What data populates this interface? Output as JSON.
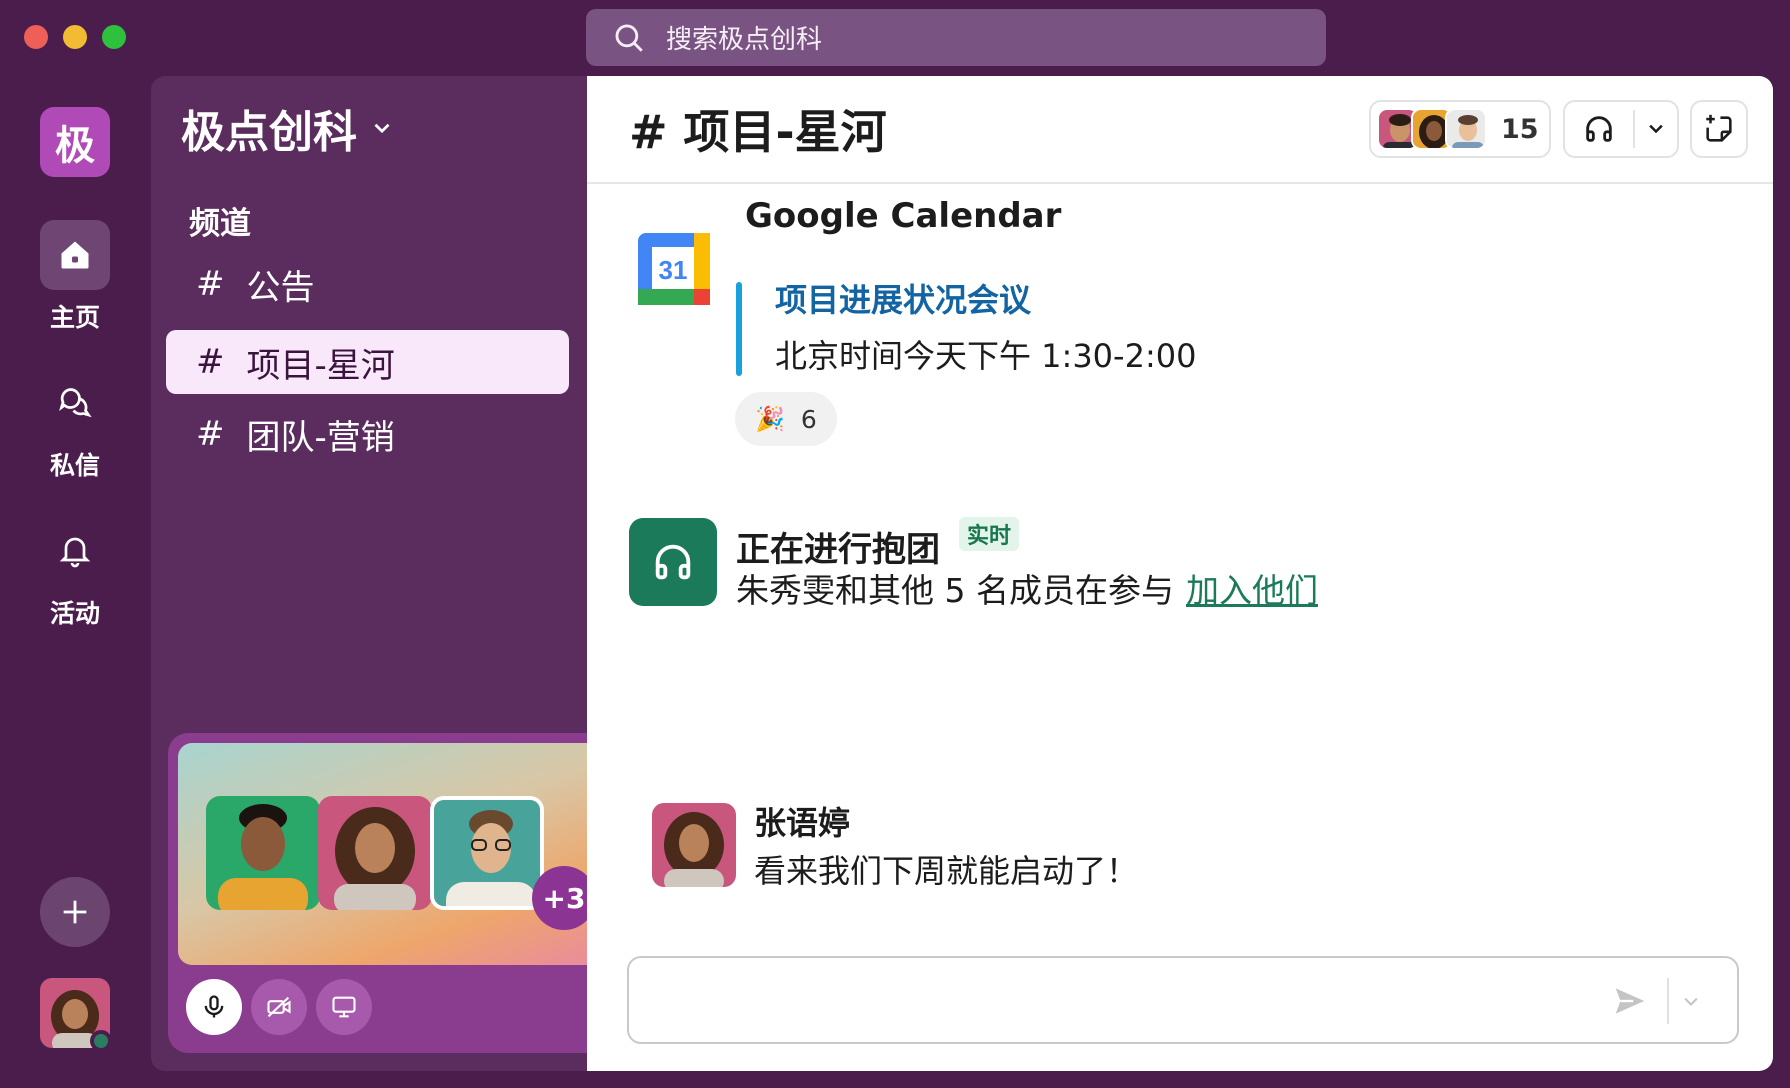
{
  "search": {
    "placeholder": "搜索极点创科"
  },
  "workspace": {
    "initial": "极",
    "name": "极点创科"
  },
  "rail": {
    "items": [
      {
        "label": "主页"
      },
      {
        "label": "私信"
      },
      {
        "label": "活动"
      }
    ]
  },
  "sidebar": {
    "section_title": "频道",
    "channels": [
      {
        "label": "公告"
      },
      {
        "label": "项目-星河"
      },
      {
        "label": "团队-营销"
      }
    ],
    "hash": "#"
  },
  "huddle_card": {
    "extra_count": "+3"
  },
  "channel": {
    "title": "# 项目-星河",
    "member_count": "15"
  },
  "messages": {
    "calendar": {
      "sender": "Google Calendar",
      "calendar_day": "31",
      "event_title": "项目进展状况会议",
      "event_time": "北京时间今天下午 1:30-2:00",
      "reaction_emoji": "🎉",
      "reaction_count": "6"
    },
    "huddle": {
      "title": "正在进行抱团",
      "badge": "实时",
      "description": "朱秀雯和其他 5 名成员在参与",
      "join_label": "加入他们"
    },
    "user": {
      "sender": "张语婷",
      "text": "看来我们下周就能启动了！"
    }
  },
  "colors": {
    "background": "#4a1d4d",
    "sidebar": "#5a2d5e",
    "accent_link": "#1264a3",
    "huddle_green": "#1a7a5a"
  }
}
